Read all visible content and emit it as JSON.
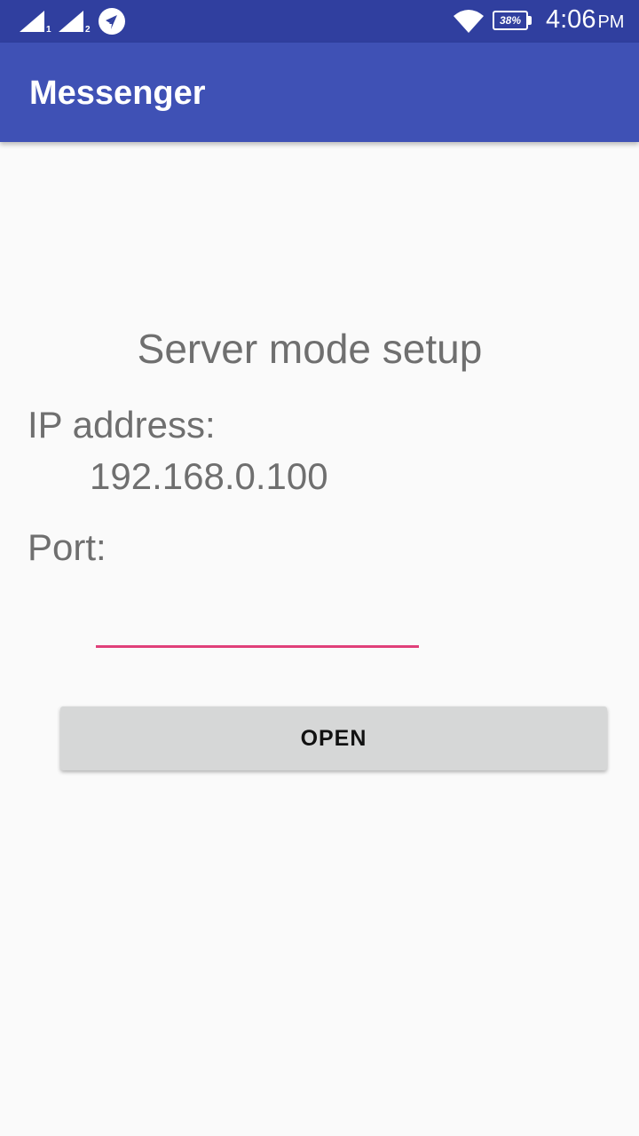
{
  "status_bar": {
    "sim1_label": "1",
    "sim2_label": "2",
    "battery_percent": "38%",
    "time": "4:06",
    "ampm": "PM",
    "icons": [
      "signal-sim1-icon",
      "signal-sim2-icon",
      "location-arrow-icon",
      "wifi-icon",
      "battery-icon"
    ]
  },
  "app_bar": {
    "title": "Messenger"
  },
  "main": {
    "setup_title": "Server mode setup",
    "ip_label": "IP address:",
    "ip_value": "192.168.0.100",
    "port_label": "Port:",
    "port_value": "",
    "open_label": "OPEN"
  },
  "colors": {
    "status_bar": "#303f9f",
    "app_bar": "#3f51b5",
    "input_underline": "#e0407a",
    "button": "#d6d7d7",
    "text": "#6f6f6f"
  }
}
